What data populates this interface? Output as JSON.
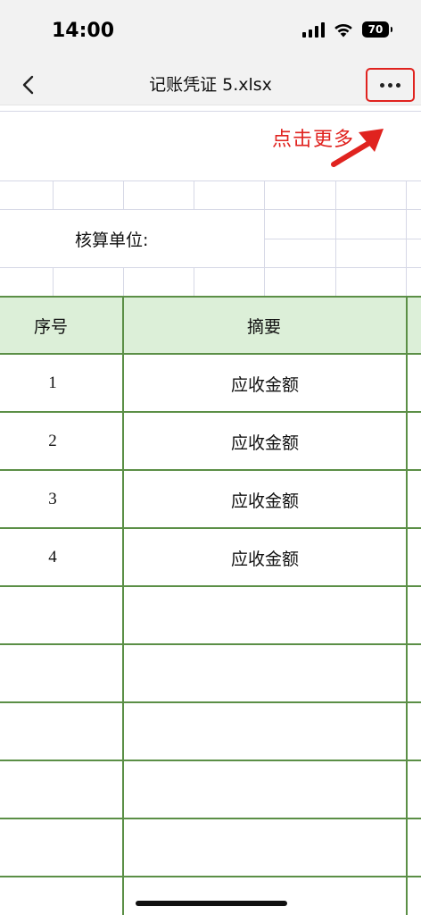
{
  "status_bar": {
    "time": "14:00",
    "battery": "70"
  },
  "nav": {
    "title": "记账凭证 5.xlsx"
  },
  "annotation": {
    "text": "点击更多",
    "color": "#e0231f"
  },
  "sheet": {
    "unit_label": "核算单位:",
    "columns": {
      "index": "序号",
      "summary": "摘要"
    },
    "rows": [
      {
        "index": "1",
        "summary": "应收金额"
      },
      {
        "index": "2",
        "summary": "应收金额"
      },
      {
        "index": "3",
        "summary": "应收金额"
      },
      {
        "index": "4",
        "summary": "应收金额"
      },
      {
        "index": "",
        "summary": ""
      },
      {
        "index": "",
        "summary": ""
      },
      {
        "index": "",
        "summary": ""
      },
      {
        "index": "",
        "summary": ""
      },
      {
        "index": "",
        "summary": ""
      }
    ],
    "header_color": "#dcefd8",
    "grid_color": "#5b8f46"
  },
  "icons": {
    "back": "chevron-left-icon",
    "more": "ellipsis-icon"
  }
}
